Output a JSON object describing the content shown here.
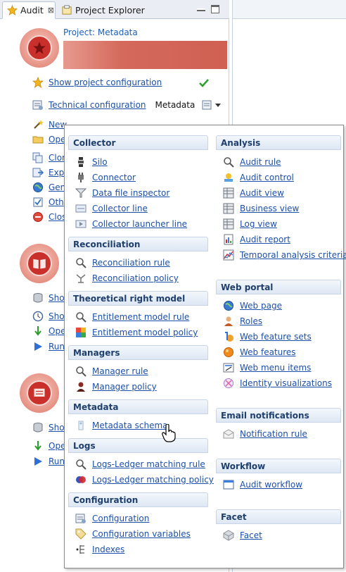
{
  "tabs": [
    {
      "label": "Audit",
      "icon": "star-icon",
      "active": true,
      "close": "⊠"
    },
    {
      "label": "Project Explorer",
      "icon": "project-explorer-icon",
      "active": false
    }
  ],
  "project": {
    "label": "Project: Metadata"
  },
  "actions": {
    "show_project_configuration": "Show project configuration",
    "technical_configuration": "Technical configuration",
    "technical_configuration_value": "Metadata"
  },
  "left_truncated_items_1": [
    "New",
    "Ope",
    "Clon",
    "Expo",
    "Gen",
    "Oth",
    "Clos"
  ],
  "left_truncated_items_2": [
    "Sho",
    "Sho",
    "Ope",
    "Run"
  ],
  "left_truncated_items_3": [
    "Sho",
    "Ope",
    "Run"
  ],
  "popup": {
    "left_column": [
      {
        "title": "Collector",
        "items": [
          "Silo",
          "Connector",
          "Data file inspector",
          "Collector line",
          "Collector launcher line"
        ]
      },
      {
        "title": "Reconciliation",
        "items": [
          "Reconciliation rule",
          "Reconciliation policy"
        ]
      },
      {
        "title": "Theoretical right model",
        "items": [
          "Entitlement model rule",
          "Entitlement model policy"
        ]
      },
      {
        "title": "Managers",
        "items": [
          "Manager rule",
          "Manager policy"
        ]
      },
      {
        "title": "Metadata",
        "items": [
          "Metadata schema"
        ]
      },
      {
        "title": "Logs",
        "items": [
          "Logs-Ledger matching rule",
          "Logs-Ledger matching policy"
        ]
      },
      {
        "title": "Configuration",
        "items": [
          "Configuration",
          "Configuration variables",
          "Indexes"
        ]
      }
    ],
    "right_column": [
      {
        "title": "Analysis",
        "items": [
          "Audit rule",
          "Audit control",
          "Audit view",
          "Business view",
          "Log view",
          "Audit report",
          "Temporal analysis criteria"
        ]
      },
      {
        "title": "Web portal",
        "items": [
          "Web page",
          "Roles",
          "Web feature sets",
          "Web features",
          "Web menu items",
          "Identity visualizations"
        ]
      },
      {
        "title": "Email notifications",
        "items": [
          "Notification rule"
        ]
      },
      {
        "title": "Workflow",
        "items": [
          "Audit workflow"
        ]
      },
      {
        "title": "Facet",
        "items": [
          "Facet"
        ]
      }
    ]
  },
  "colors": {
    "link": "#1c4fa8",
    "section_text": "#1f3f6e",
    "accent_red": "#c9302c"
  }
}
